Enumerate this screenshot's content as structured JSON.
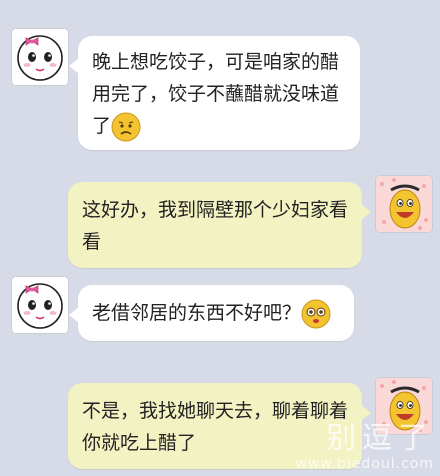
{
  "messages": [
    {
      "side": "left",
      "text": "晚上想吃饺子，可是咱家的醋用完了，饺子不蘸醋就没味道了",
      "emoji": "sad-face-emoji"
    },
    {
      "side": "right",
      "text": "这好办，我到隔壁那个少妇家看看"
    },
    {
      "side": "left",
      "text": "老借邻居的东西不好吧？",
      "emoji": "wide-eyed-face-emoji"
    },
    {
      "side": "right",
      "text": "不是，我找她聊天去，聊着聊着你就吃上醋了"
    }
  ],
  "colors": {
    "background": "#d7dbe7",
    "left_bubble": "#ffffff",
    "right_bubble": "#f3f2c2",
    "emoji_yellow": "#f4c430"
  },
  "watermark": {
    "main": "别逗了",
    "url": "www.biedoul.com"
  }
}
